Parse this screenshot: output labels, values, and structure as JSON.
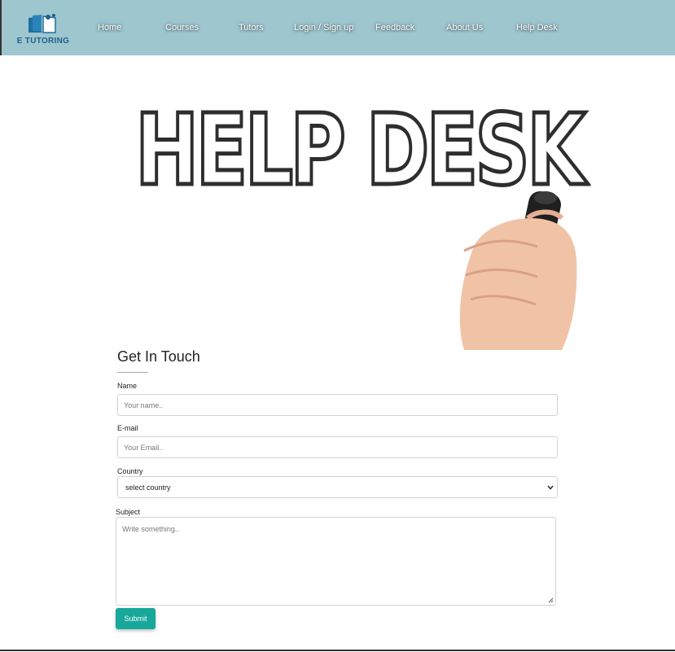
{
  "brand": {
    "name": "E TUTORING"
  },
  "nav": {
    "items": [
      "Home",
      "Courses",
      "Tutors",
      "Login / Sign up",
      "Feedback",
      "About Us",
      "Help Desk"
    ]
  },
  "hero": {
    "text": "HELP DESK"
  },
  "form": {
    "title": "Get In Touch",
    "name_label": "Name",
    "name_placeholder": "Your name..",
    "email_label": "E-mail",
    "email_placeholder": "Your Email..",
    "country_label": "Country",
    "country_selected": "select country",
    "subject_label": "Subject",
    "subject_placeholder": "Write something..",
    "submit_label": "Submit"
  },
  "colors": {
    "header_bg": "#9ec6cf",
    "accent": "#17a89b",
    "brand_text": "#1f5f8b"
  }
}
